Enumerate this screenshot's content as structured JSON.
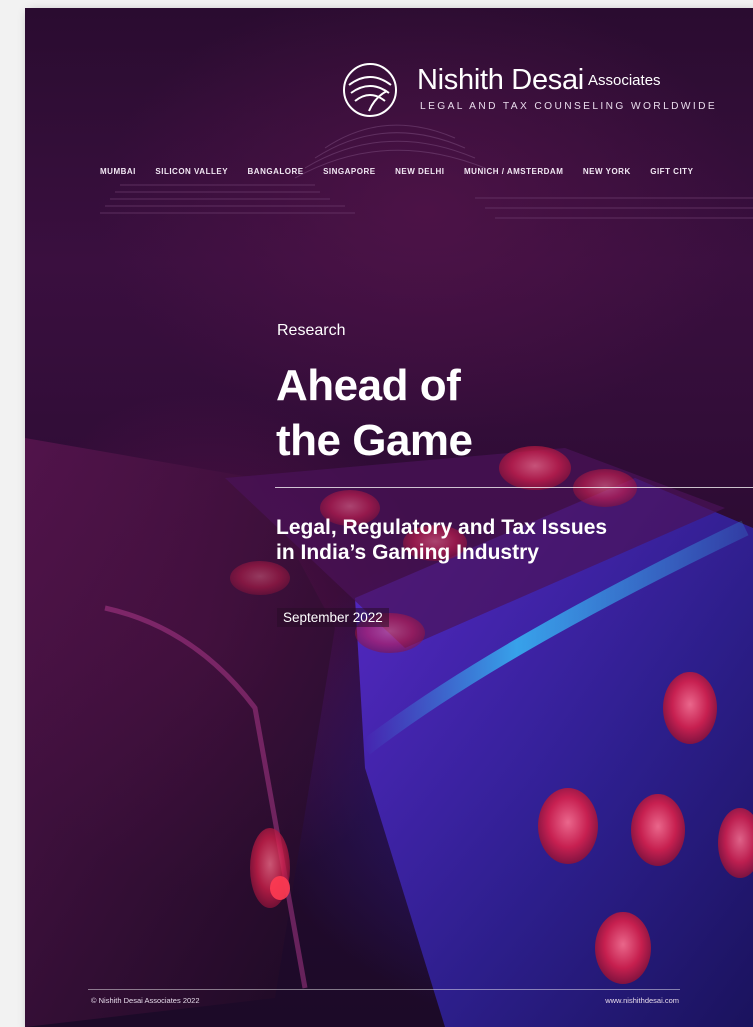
{
  "brand": {
    "name": "Nishith Desai",
    "name_suffix": "Associates",
    "tagline": "LEGAL AND TAX COUNSELING WORLDWIDE"
  },
  "cities": [
    "MUMBAI",
    "SILICON VALLEY",
    "BANGALORE",
    "SINGAPORE",
    "NEW DELHI",
    "MUNICH / AMSTERDAM",
    "NEW YORK",
    "GIFT CITY"
  ],
  "cover": {
    "kicker": "Research",
    "title_line1": "Ahead of",
    "title_line2": "the Game",
    "subtitle_line1": "Legal, Regulatory and Tax Issues",
    "subtitle_line2": "in India’s Gaming Industry",
    "date": "September 2022"
  },
  "footer": {
    "copyright": "© Nishith Desai Associates 2022",
    "website": "www.nishithdesai.com"
  },
  "colors": {
    "background": "#2a0c30",
    "dice_blue": "#3c2ab0",
    "pip_red": "#d8204a",
    "text": "#ffffff"
  }
}
